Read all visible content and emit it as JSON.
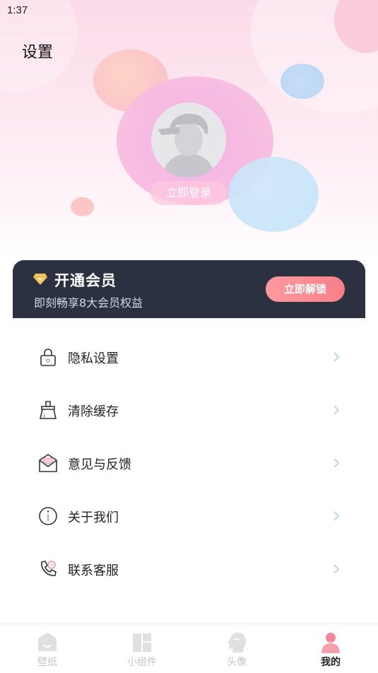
{
  "status_bar": {
    "time": "1:37"
  },
  "header": {
    "title": "设置"
  },
  "profile": {
    "login_label": "立即登录"
  },
  "vip": {
    "title": "开通会员",
    "subtitle": "即刻畅享8大会员权益",
    "button_label": "立即解锁",
    "button_color": "#f7868f"
  },
  "menu": {
    "items": [
      {
        "label": "隐私设置",
        "icon": "lock-icon"
      },
      {
        "label": "清除缓存",
        "icon": "broom-icon"
      },
      {
        "label": "意见与反馈",
        "icon": "mail-icon"
      },
      {
        "label": "关于我们",
        "icon": "info-icon"
      },
      {
        "label": "联系客服",
        "icon": "phone-icon"
      }
    ]
  },
  "tabbar": {
    "tabs": [
      {
        "label": "壁纸",
        "icon": "wallpaper-icon",
        "active": false
      },
      {
        "label": "小组件",
        "icon": "widget-grid-icon",
        "active": false
      },
      {
        "label": "头像",
        "icon": "head-profile-icon",
        "active": false
      },
      {
        "label": "我的",
        "icon": "user-icon",
        "active": true
      }
    ],
    "active_color": "#f48a99",
    "inactive_color": "#e0e0e0"
  }
}
